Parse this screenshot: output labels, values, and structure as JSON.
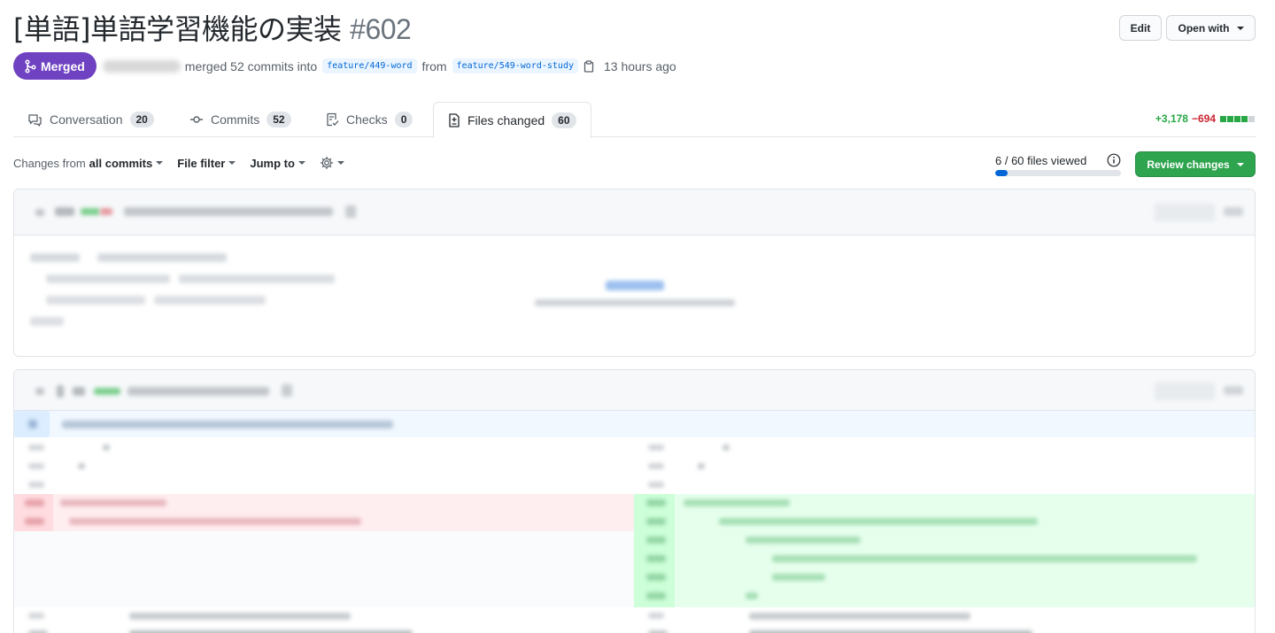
{
  "pr": {
    "title": "[単語]単語学習機能の実装",
    "number": "#602",
    "state": "Merged",
    "merge_text": "merged 52 commits into",
    "base_branch": "feature/449-word",
    "from_text": "from",
    "head_branch": "feature/549-word-study",
    "time": "13 hours ago"
  },
  "header_buttons": {
    "edit": "Edit",
    "open_with": "Open with"
  },
  "tabs": [
    {
      "label": "Conversation",
      "count": "20",
      "icon": "comment-icon"
    },
    {
      "label": "Commits",
      "count": "52",
      "icon": "commit-icon"
    },
    {
      "label": "Checks",
      "count": "0",
      "icon": "checks-icon"
    },
    {
      "label": "Files changed",
      "count": "60",
      "icon": "file-diff-icon",
      "active": true
    }
  ],
  "diffstat": {
    "additions": "+3,178",
    "deletions": "−694"
  },
  "toolbar": {
    "changes_from_prefix": "Changes from",
    "changes_from_value": "all commits",
    "file_filter": "File filter",
    "jump_to": "Jump to"
  },
  "review": {
    "viewed_text": "6 / 60 files viewed",
    "viewed_fraction": 0.1,
    "button": "Review changes"
  },
  "colors": {
    "merged": "#6f42c1",
    "add": "#28a745",
    "del": "#cb2431",
    "review_button": "#2ea44f",
    "progress": "#0366d6"
  }
}
